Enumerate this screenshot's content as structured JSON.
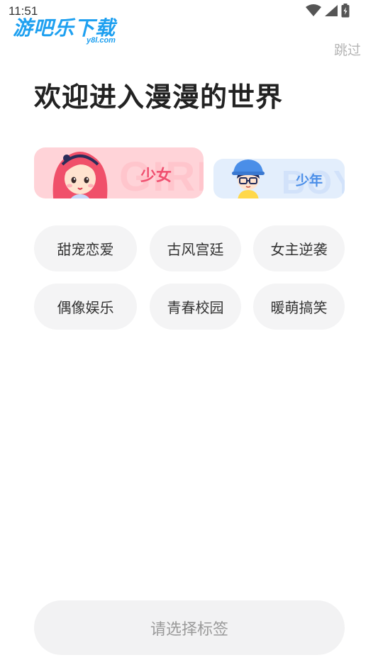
{
  "status_bar": {
    "time": "11:51",
    "icons": [
      "wifi-icon",
      "cellular-signal-icon",
      "battery-icon"
    ]
  },
  "watermark": {
    "text_cn": "游吧乐下载",
    "text_en": "y8l.com"
  },
  "header": {
    "skip_label": "跳过",
    "title": "欢迎进入漫漫的世界"
  },
  "gender": {
    "girl": {
      "label": "少女",
      "bg_word": "GIRL",
      "selected": true
    },
    "boy": {
      "label": "少年",
      "bg_word": "BOY",
      "selected": false
    }
  },
  "tags": [
    [
      "甜宠恋爱",
      "古风宫廷",
      "女主逆袭"
    ],
    [
      "偶像娱乐",
      "青春校园",
      "暖萌搞笑"
    ]
  ],
  "footer": {
    "confirm_label": "请选择标签"
  },
  "colors": {
    "girl_card": "#ffd3d8",
    "girl_accent": "#f05070",
    "boy_card": "#e3eefc",
    "boy_accent": "#4a8ee8",
    "tag_bg": "#f4f4f5",
    "button_bg": "#f2f2f3"
  }
}
